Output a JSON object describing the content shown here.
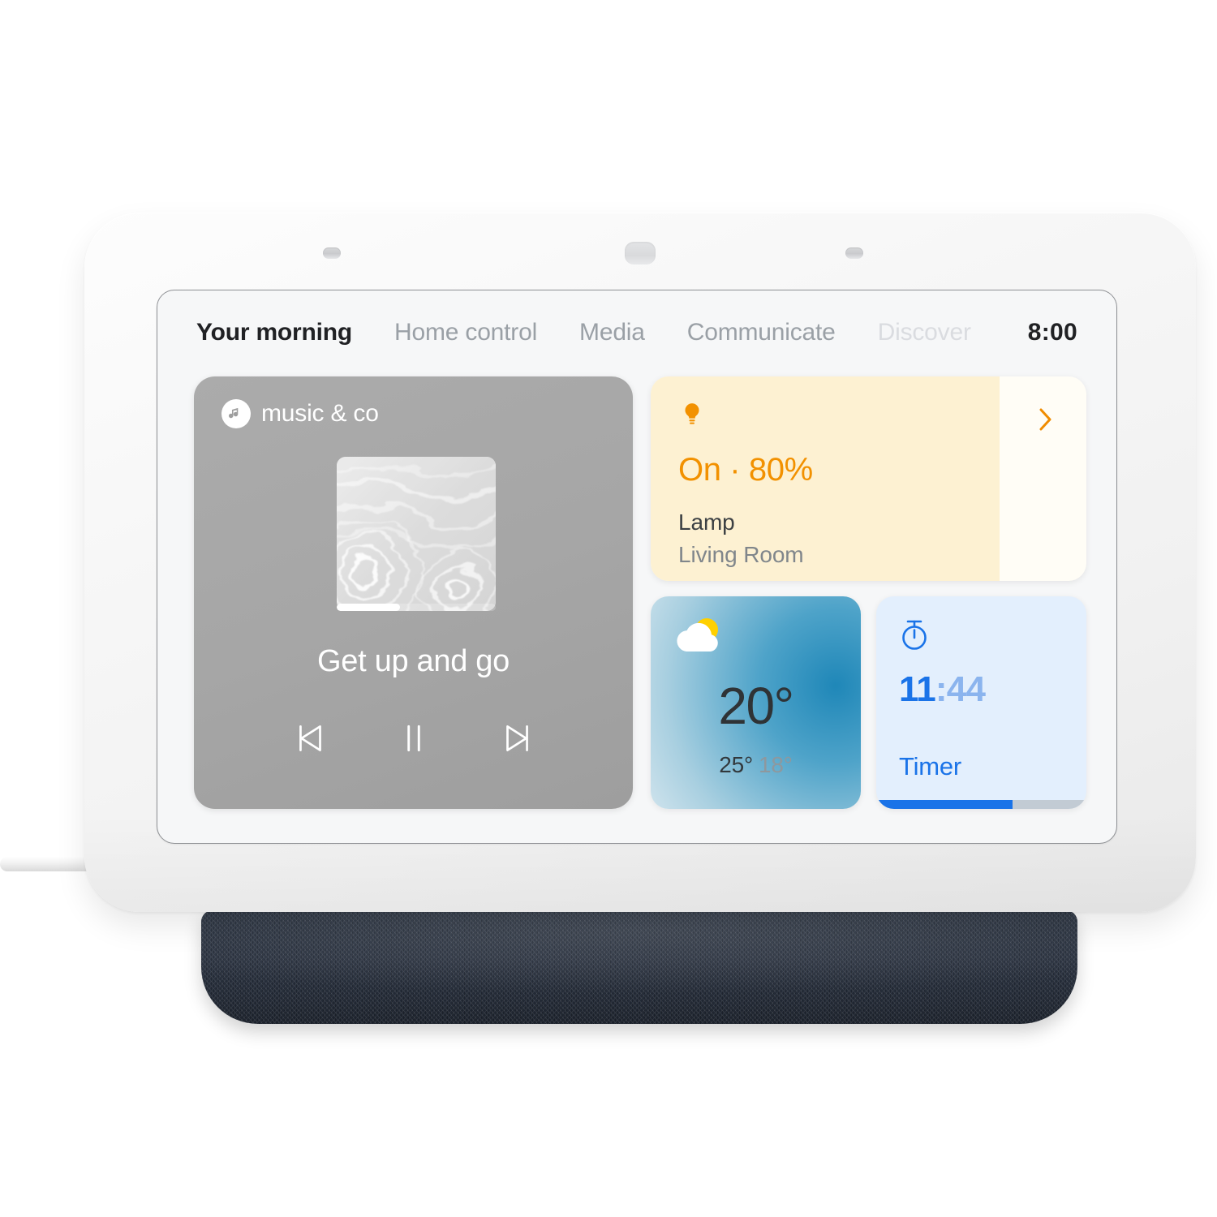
{
  "device": {
    "name": "Google Nest Hub",
    "shell_color": "#f4f4f4",
    "base_color": "#2a3240"
  },
  "nav": {
    "tabs": [
      {
        "label": "Your morning",
        "state": "active"
      },
      {
        "label": "Home control",
        "state": "inactive"
      },
      {
        "label": "Media",
        "state": "inactive"
      },
      {
        "label": "Communicate",
        "state": "inactive"
      },
      {
        "label": "Discover",
        "state": "muted"
      }
    ],
    "clock": "8:00"
  },
  "media_card": {
    "provider": "music & co",
    "provider_icon": "music-note-icon",
    "album_art_alt": "water-ripples-album-art",
    "track_title": "Get up and go",
    "progress_percent": 40,
    "controls": [
      {
        "name": "previous-track",
        "icon": "skip-previous-icon"
      },
      {
        "name": "pause",
        "icon": "pause-icon"
      },
      {
        "name": "next-track",
        "icon": "skip-next-icon"
      }
    ]
  },
  "lamp_card": {
    "icon": "light-bulb-icon",
    "state_text": "On · 80%",
    "brightness_percent": 80,
    "device_name": "Lamp",
    "room_name": "Living Room",
    "chevron_icon": "chevron-right-icon",
    "accent_color": "#f29100",
    "fill_color": "#fdf1d2"
  },
  "weather_card": {
    "icon": "partly-cloudy-icon",
    "temperature": "20°",
    "high": "25°",
    "low": "18°"
  },
  "timer_card": {
    "icon": "stopwatch-icon",
    "minutes": "11",
    "separator_seconds": ":44",
    "label": "Timer",
    "progress_percent": 65,
    "accent_color": "#1a73e8"
  }
}
